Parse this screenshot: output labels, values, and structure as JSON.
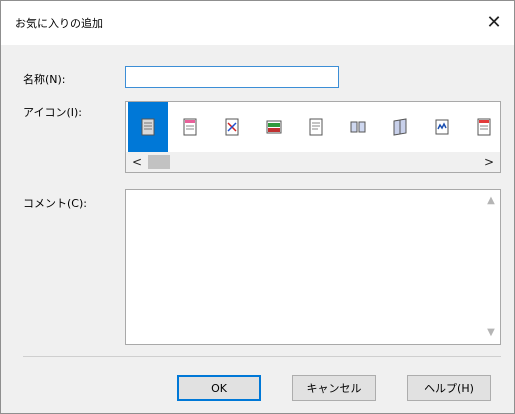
{
  "dialog": {
    "title": "お気に入りの追加",
    "close_label": "✕"
  },
  "form": {
    "name_label": "名称(N):",
    "name_value": "",
    "icon_label": "アイコン(I):",
    "icons": [
      {
        "name": "document-gray-icon",
        "selected": true
      },
      {
        "name": "document-pink-icon"
      },
      {
        "name": "document-cut-icon"
      },
      {
        "name": "document-green-icon"
      },
      {
        "name": "document-plain-icon"
      },
      {
        "name": "document-split-icon"
      },
      {
        "name": "document-fold-icon"
      },
      {
        "name": "document-wave-icon"
      },
      {
        "name": "document-red-icon"
      }
    ],
    "scroll_left": "<",
    "scroll_right": ">",
    "comment_label": "コメント(C):",
    "comment_value": "",
    "scroll_up": "▲",
    "scroll_down": "▼"
  },
  "buttons": {
    "ok": "OK",
    "cancel": "キャンセル",
    "help": "ヘルプ(H)"
  },
  "colors": {
    "selection": "#0078d7",
    "input_focus_border": "#3c8ed6"
  }
}
